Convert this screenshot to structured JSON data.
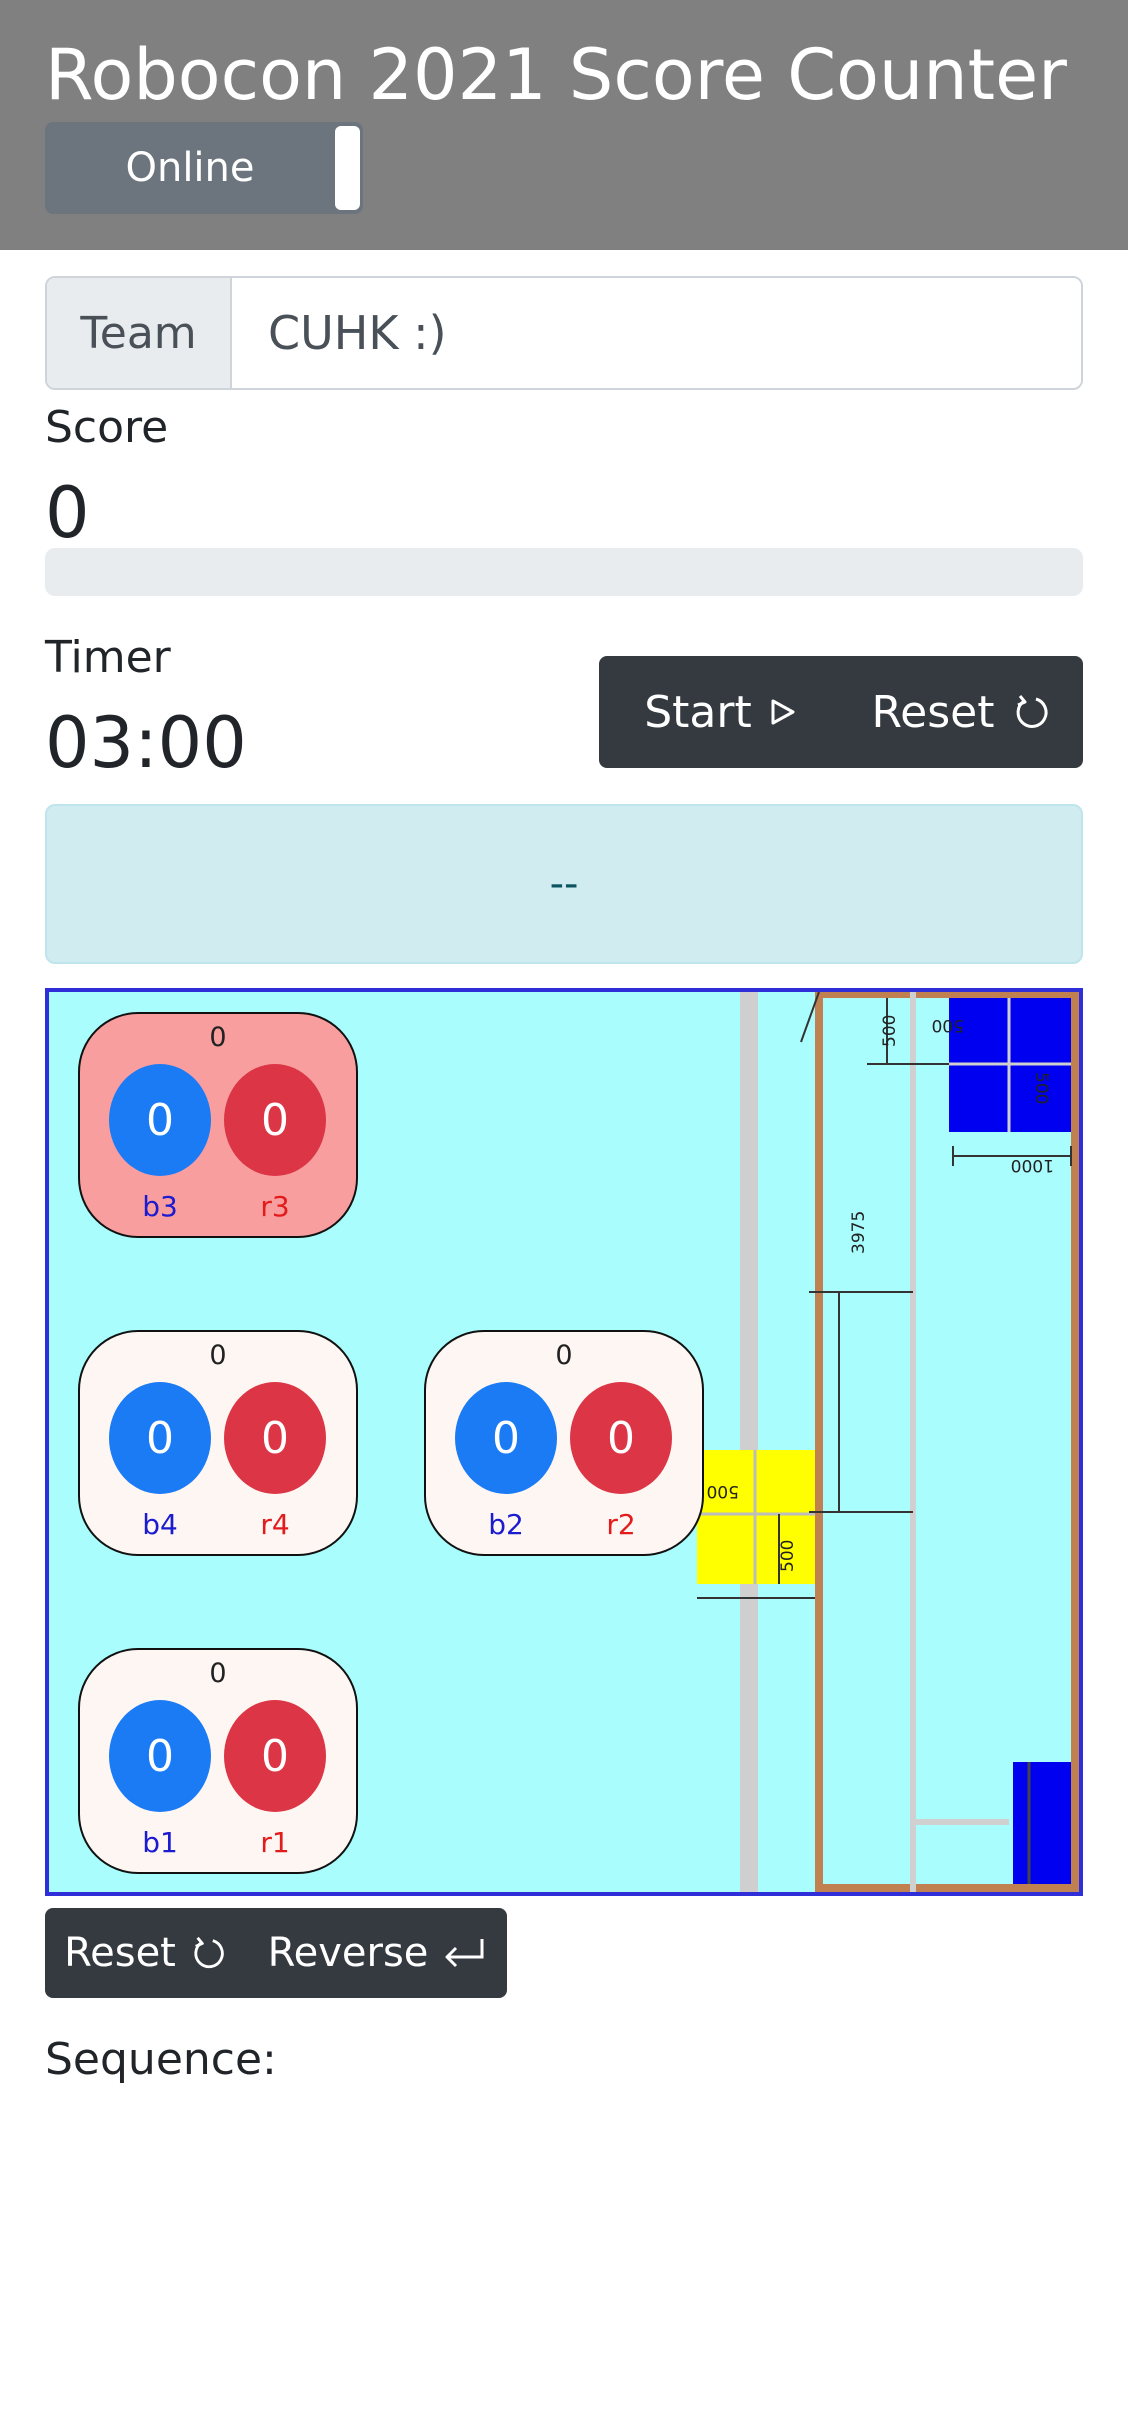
{
  "header": {
    "title": "Robocon 2021 Score Counter",
    "online_label": "Online"
  },
  "team": {
    "prefix": "Team",
    "value": "CUHK :)"
  },
  "score": {
    "label": "Score",
    "value": "0",
    "progress_fraction": 0
  },
  "timer": {
    "label": "Timer",
    "value": "03:00",
    "start_label": "Start",
    "reset_label": "Reset"
  },
  "status": {
    "text": "--"
  },
  "field": {
    "dimensions": [
      "500",
      "500",
      "500",
      "1000",
      "3975",
      "500",
      "500"
    ],
    "pots": [
      {
        "id": "pot3",
        "total": "0",
        "blue": "0",
        "red": "0",
        "blue_tag": "b3",
        "red_tag": "r3",
        "highlighted": true
      },
      {
        "id": "pot4",
        "total": "0",
        "blue": "0",
        "red": "0",
        "blue_tag": "b4",
        "red_tag": "r4",
        "highlighted": false
      },
      {
        "id": "pot2",
        "total": "0",
        "blue": "0",
        "red": "0",
        "blue_tag": "b2",
        "red_tag": "r2",
        "highlighted": false
      },
      {
        "id": "pot1",
        "total": "0",
        "blue": "0",
        "red": "0",
        "blue_tag": "b1",
        "red_tag": "r1",
        "highlighted": false
      }
    ]
  },
  "controls": {
    "reset_label": "Reset",
    "reverse_label": "Reverse"
  },
  "sequence": {
    "label": "Sequence:"
  },
  "colors": {
    "header_bg": "#808080",
    "field_bg": "#a9fdfd",
    "blue_ball": "#1a7bf5",
    "red_ball": "#dc3545",
    "highlight_pot": "#f89e9e",
    "dark_button": "#343a40"
  }
}
